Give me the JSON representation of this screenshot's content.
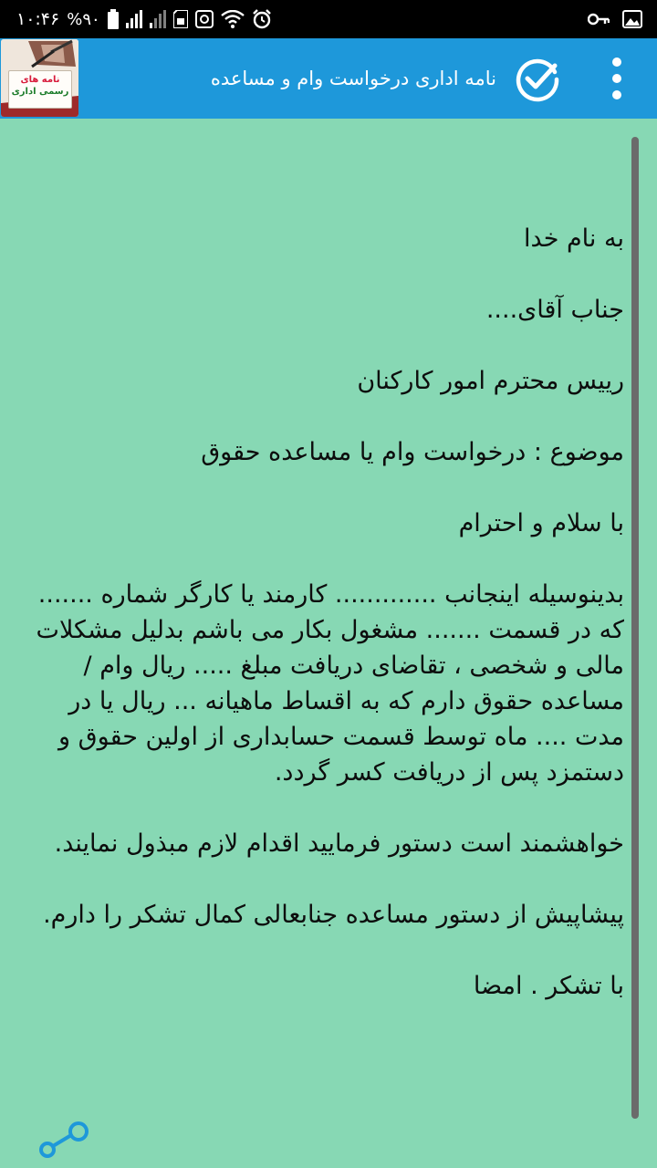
{
  "status_bar": {
    "time": "۱۰:۴۶",
    "battery_percent": "%۹۰",
    "left_icons": [
      "battery-icon",
      "signal-icon",
      "signal-icon",
      "sim-icon",
      "data-saver-icon",
      "wifi-icon",
      "alarm-icon"
    ],
    "right_icons": [
      "key-icon",
      "image-icon"
    ]
  },
  "app_bar": {
    "title": "نامه اداری درخواست وام و مساعده",
    "logo_line1": "نامه های",
    "logo_line2": "رسمی اداری",
    "accent_color": "#1e98da"
  },
  "letter": {
    "greeting": "به نام خدا",
    "salutation": "جناب آقای....",
    "position": "رییس محترم امور کارکنان",
    "subject": "موضوع : درخواست وام یا مساعده حقوق",
    "opening": "با سلام و احترام",
    "body": "بدینوسیله اینجانب  ............. کارمند یا کارگر شماره ....... که در قسمت ....... مشغول بکار می باشم بدلیل مشکلات مالی و شخصی ، تقاضای دریافت  مبلغ ..... ریال وام / مساعده حقوق دارم که به اقساط ماهیانه ... ریال یا در مدت .... ماه توسط قسمت حسابداری از اولین حقوق و دستمزد پس از دریافت کسر گردد.",
    "request": "خواهشمند است دستور فرمایید اقدام لازم مبذول نمایند.",
    "thanks": "پیشاپیش از دستور مساعده جنابعالی کمال تشکر را دارم.",
    "closing": "با تشکر . امضا"
  },
  "colors": {
    "background": "#87d8b4",
    "app_bar": "#1e98da",
    "share_icon": "#1e98da"
  }
}
